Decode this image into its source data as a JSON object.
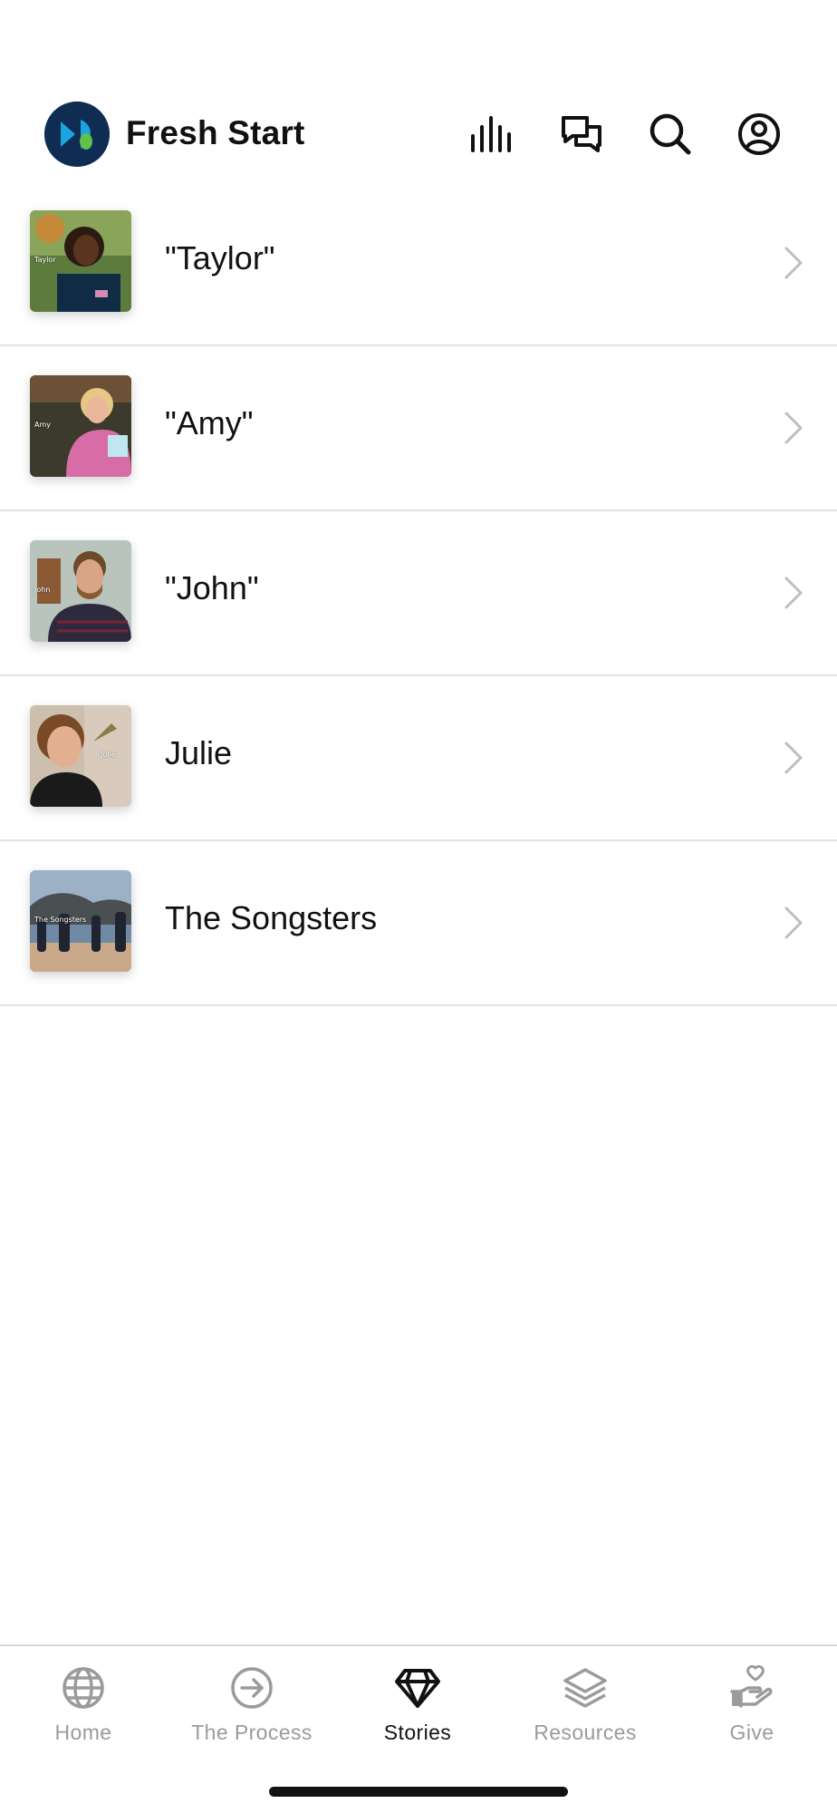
{
  "app": {
    "title": "Fresh Start",
    "brand_colors": {
      "dark": "#0f2d52",
      "blue": "#1aa4e0",
      "green": "#5fc24a"
    }
  },
  "header": {
    "icons": [
      "bar-chart-icon",
      "chat-bubbles-icon",
      "search-icon",
      "account-icon"
    ]
  },
  "stories": [
    {
      "title": "\"Taylor\"",
      "thumb_caption": "Taylor"
    },
    {
      "title": "\"Amy\"",
      "thumb_caption": "Amy"
    },
    {
      "title": "\"John\"",
      "thumb_caption": "John"
    },
    {
      "title": "Julie",
      "thumb_caption": "Julie"
    },
    {
      "title": "The Songsters",
      "thumb_caption": "The Songsters"
    }
  ],
  "tabs": [
    {
      "label": "Home",
      "icon": "globe-icon",
      "active": false
    },
    {
      "label": "The Process",
      "icon": "arrow-circle-icon",
      "active": false
    },
    {
      "label": "Stories",
      "icon": "diamond-icon",
      "active": true
    },
    {
      "label": "Resources",
      "icon": "layers-icon",
      "active": false
    },
    {
      "label": "Give",
      "icon": "heart-hand-icon",
      "active": false
    }
  ],
  "colors": {
    "inactive_tab": "#9b9b9b",
    "active_tab": "#111111",
    "divider": "#e3e3e3"
  }
}
